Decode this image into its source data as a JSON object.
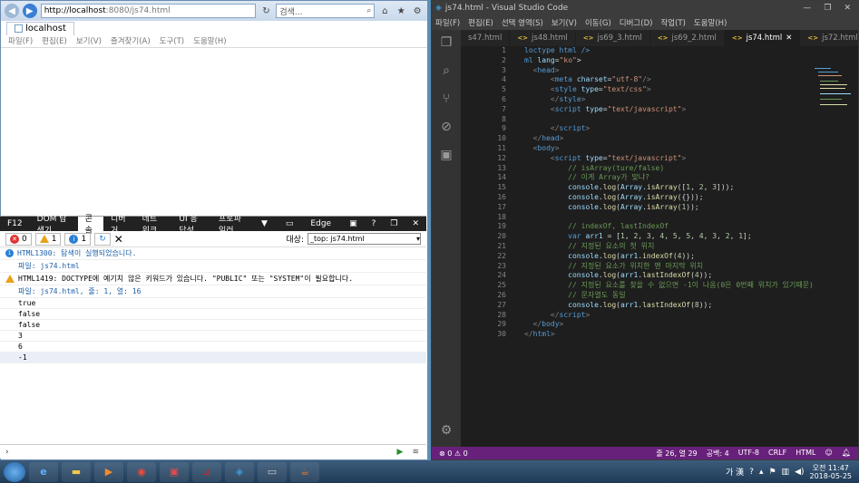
{
  "ie": {
    "url_host": "http://localhost",
    "url_rest": ":8080/js74.html",
    "search_placeholder": "검색...",
    "tab_title": "localhost",
    "menu": [
      "파일(F)",
      "편집(E)",
      "보기(V)",
      "즐겨찾기(A)",
      "도구(T)",
      "도움말(H)"
    ]
  },
  "devtools": {
    "tabs": [
      "F12",
      "DOM 탐색기",
      "콘솔",
      "디버거",
      "네트워크",
      "UI 응답성",
      "프로파일러"
    ],
    "mode": "Edge",
    "error_count": "0",
    "warn_count": "1",
    "info_count": "1",
    "target_label": "대상:",
    "target_value": "_top: js74.html",
    "console": [
      {
        "type": "info",
        "text": "HTML1300: 탐색이 실행되었습니다."
      },
      {
        "type": "sub",
        "text": "파일: js74.html"
      },
      {
        "type": "warn",
        "text": "HTML1419: DOCTYPE에 예기치 않은 키워드가 있습니다. \"PUBLIC\" 또는 \"SYSTEM\"이 필요합니다."
      },
      {
        "type": "sub",
        "text": "파일: js74.html, 줄: 1, 열: 16"
      },
      {
        "type": "plain",
        "text": "true"
      },
      {
        "type": "plain",
        "text": "false"
      },
      {
        "type": "plain",
        "text": "false"
      },
      {
        "type": "plain",
        "text": "3"
      },
      {
        "type": "plain",
        "text": "6"
      },
      {
        "type": "plain",
        "text": "-1"
      }
    ]
  },
  "vscode": {
    "title": "js74.html - Visual Studio Code",
    "menu": [
      "파일(F)",
      "편집(E)",
      "선택 영역(S)",
      "보기(V)",
      "이동(G)",
      "디버그(D)",
      "작업(T)",
      "도움말(H)"
    ],
    "tabs": [
      {
        "label": "s47.html",
        "active": false
      },
      {
        "label": "js48.html",
        "active": false
      },
      {
        "label": "js69_3.html",
        "active": false
      },
      {
        "label": "js69_2.html",
        "active": false
      },
      {
        "label": "js74.html",
        "active": true
      },
      {
        "label": "js72.html",
        "active": false
      }
    ],
    "line_numbers": [
      "1",
      "2",
      "3",
      "4",
      "5",
      "6",
      "7",
      "8",
      "9",
      "10",
      "11",
      "12",
      "13",
      "14",
      "15",
      "16",
      "17",
      "18",
      "19",
      "20",
      "21",
      "22",
      "23",
      "24",
      "25",
      "26",
      "27",
      "28",
      "29",
      "30"
    ],
    "status": {
      "errors": "0",
      "warnings": "0",
      "position": "줄 26, 열 29",
      "spaces": "공백: 4",
      "encoding": "UTF-8",
      "eol": "CRLF",
      "language": "HTML"
    }
  },
  "taskbar": {
    "ime": "가 漢",
    "time": "오전 11:47",
    "date": "2018-05-25"
  }
}
